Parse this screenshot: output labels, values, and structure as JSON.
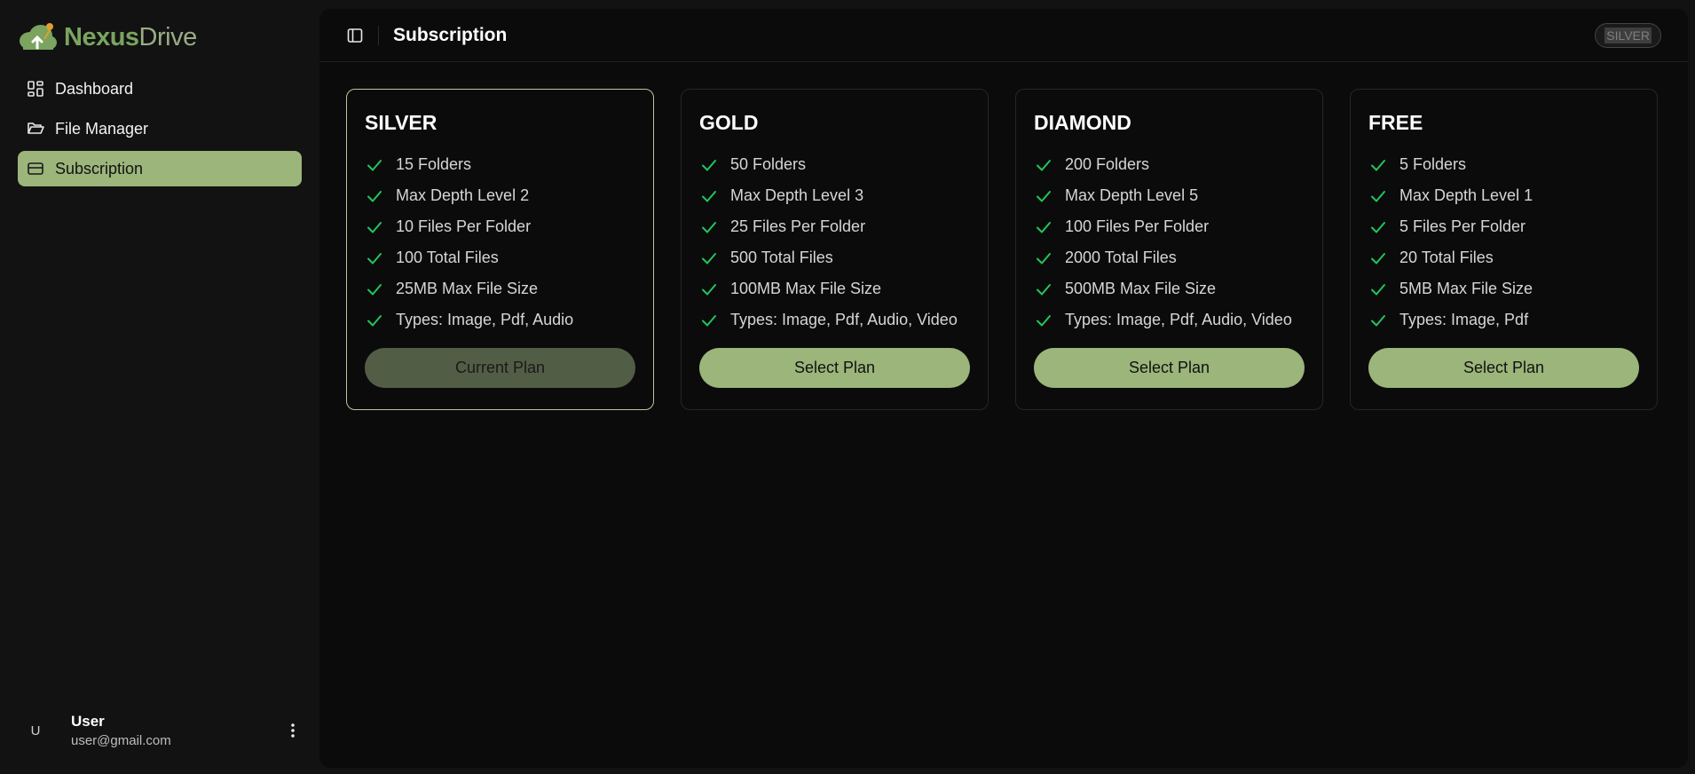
{
  "brand": {
    "part1": "Nexus",
    "part2": "Drive"
  },
  "sidebar": {
    "items": [
      {
        "label": "Dashboard",
        "icon": "dashboard-grid-icon"
      },
      {
        "label": "File Manager",
        "icon": "folder-open-icon"
      },
      {
        "label": "Subscription",
        "icon": "credit-card-icon",
        "active": true
      }
    ]
  },
  "user": {
    "initial": "U",
    "name": "User",
    "email": "user@gmail.com"
  },
  "header": {
    "title": "Subscription",
    "current_plan_badge": "SILVER"
  },
  "plans": [
    {
      "name": "SILVER",
      "features": [
        "15 Folders",
        "Max Depth Level 2",
        "10 Files Per Folder",
        "100 Total Files",
        "25MB Max File Size",
        "Types: Image, Pdf, Audio"
      ],
      "button": "Current Plan",
      "current": true
    },
    {
      "name": "GOLD",
      "features": [
        "50 Folders",
        "Max Depth Level 3",
        "25 Files Per Folder",
        "500 Total Files",
        "100MB Max File Size",
        "Types: Image, Pdf, Audio, Video"
      ],
      "button": "Select Plan",
      "current": false
    },
    {
      "name": "DIAMOND",
      "features": [
        "200 Folders",
        "Max Depth Level 5",
        "100 Files Per Folder",
        "2000 Total Files",
        "500MB Max File Size",
        "Types: Image, Pdf, Audio, Video"
      ],
      "button": "Select Plan",
      "current": false
    },
    {
      "name": "FREE",
      "features": [
        "5 Folders",
        "Max Depth Level 1",
        "5 Files Per Folder",
        "20 Total Files",
        "5MB Max File Size",
        "Types: Image, Pdf"
      ],
      "button": "Select Plan",
      "current": false
    }
  ],
  "colors": {
    "accent": "#9bb57a",
    "check": "#22c55e",
    "background": "#0b0b0b"
  }
}
